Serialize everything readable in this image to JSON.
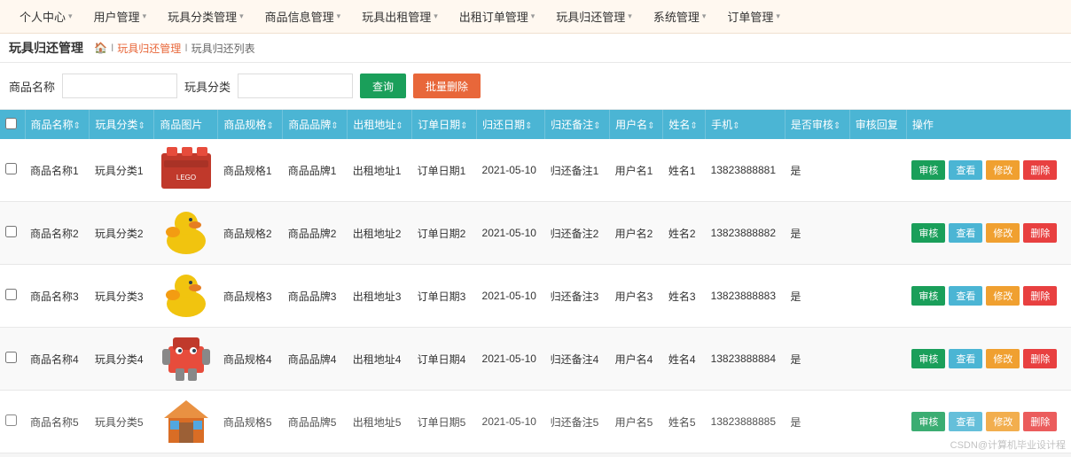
{
  "nav": {
    "items": [
      {
        "label": "个人中心",
        "id": "personal"
      },
      {
        "label": "用户管理",
        "id": "user"
      },
      {
        "label": "玩具分类管理",
        "id": "category"
      },
      {
        "label": "商品信息管理",
        "id": "product"
      },
      {
        "label": "玩具出租管理",
        "id": "rental"
      },
      {
        "label": "出租订单管理",
        "id": "order"
      },
      {
        "label": "玩具归还管理",
        "id": "return"
      },
      {
        "label": "系统管理",
        "id": "system"
      },
      {
        "label": "订单管理",
        "id": "order2"
      }
    ]
  },
  "breadcrumb": {
    "title": "玩具归还管理",
    "home_icon": "🏠",
    "path1": "玩具归还管理",
    "sep1": "I",
    "path2": "玩具归还列表"
  },
  "search": {
    "label1": "商品名称",
    "label2": "玩具分类",
    "placeholder1": "",
    "placeholder2": "",
    "search_btn": "查询",
    "batch_delete_btn": "批量删除"
  },
  "table": {
    "headers": [
      {
        "label": "商品名称",
        "id": "name"
      },
      {
        "label": "玩具分类",
        "id": "category"
      },
      {
        "label": "商品图片",
        "id": "image"
      },
      {
        "label": "商品规格",
        "id": "spec"
      },
      {
        "label": "商品品牌",
        "id": "brand"
      },
      {
        "label": "出租地址",
        "id": "address"
      },
      {
        "label": "订单日期",
        "id": "order_date"
      },
      {
        "label": "归还日期",
        "id": "return_date"
      },
      {
        "label": "归还备注",
        "id": "remark"
      },
      {
        "label": "用户名",
        "id": "username"
      },
      {
        "label": "姓名",
        "id": "fullname"
      },
      {
        "label": "手机",
        "id": "phone"
      },
      {
        "label": "是否审核",
        "id": "audited"
      },
      {
        "label": "审核回复",
        "id": "audit_reply"
      },
      {
        "label": "操作",
        "id": "action"
      }
    ],
    "rows": [
      {
        "name": "商品名称1",
        "category": "玩具分类1",
        "image_type": "lego",
        "spec": "商品规格1",
        "brand": "商品品牌1",
        "address": "出租地址1",
        "order_date": "订单日期1",
        "return_date": "2021-05-10",
        "remark": "归还备注1",
        "username": "用户名1",
        "fullname": "姓名1",
        "phone": "13823888881",
        "audited": "是",
        "audit_reply": ""
      },
      {
        "name": "商品名称2",
        "category": "玩具分类2",
        "image_type": "duck",
        "spec": "商品规格2",
        "brand": "商品品牌2",
        "address": "出租地址2",
        "order_date": "订单日期2",
        "return_date": "2021-05-10",
        "remark": "归还备注2",
        "username": "用户名2",
        "fullname": "姓名2",
        "phone": "13823888882",
        "audited": "是",
        "audit_reply": ""
      },
      {
        "name": "商品名称3",
        "category": "玩具分类3",
        "image_type": "duck",
        "spec": "商品规格3",
        "brand": "商品品牌3",
        "address": "出租地址3",
        "order_date": "订单日期3",
        "return_date": "2021-05-10",
        "remark": "归还备注3",
        "username": "用户名3",
        "fullname": "姓名3",
        "phone": "13823888883",
        "audited": "是",
        "audit_reply": ""
      },
      {
        "name": "商品名称4",
        "category": "玩具分类4",
        "image_type": "robot",
        "spec": "商品规格4",
        "brand": "商品品牌4",
        "address": "出租地址4",
        "order_date": "订单日期4",
        "return_date": "2021-05-10",
        "remark": "归还备注4",
        "username": "用户名4",
        "fullname": "姓名4",
        "phone": "13823888884",
        "audited": "是",
        "audit_reply": ""
      },
      {
        "name": "商品名称5",
        "category": "玩具分类5",
        "image_type": "house",
        "spec": "商品规格5",
        "brand": "商品品牌5",
        "address": "出租地址5",
        "order_date": "订单日期5",
        "return_date": "2021-05-10",
        "remark": "归还备注5",
        "username": "用户名5",
        "fullname": "姓名5",
        "phone": "13823888885",
        "audited": "是",
        "audit_reply": ""
      }
    ],
    "action_btns": {
      "audit": "审核",
      "view": "查看",
      "edit": "修改",
      "delete": "删除"
    }
  },
  "watermark": "CSDN@计算机毕业设计程"
}
